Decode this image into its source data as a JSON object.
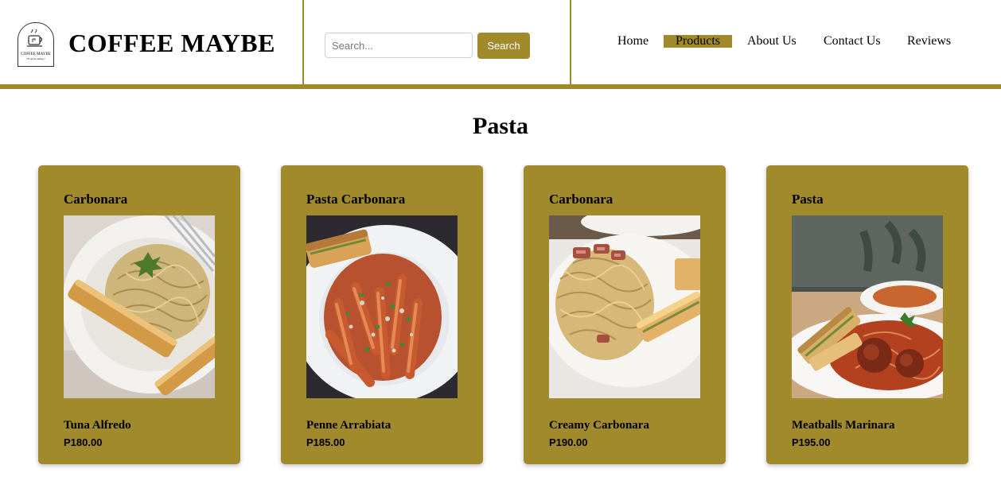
{
  "brand": {
    "name": "COFFEE MAYBE",
    "logo_text": "COFFEE MAYBE",
    "logo_tagline": "\"E sarns muitay\""
  },
  "search": {
    "placeholder": "Search...",
    "value": "",
    "button_label": "Search"
  },
  "nav": {
    "items": [
      "Home",
      "Products",
      "About Us",
      "Contact Us",
      "Reviews"
    ],
    "active": "Products"
  },
  "page": {
    "title": "Pasta"
  },
  "products": [
    {
      "category": "Carbonara",
      "name": "Tuna Alfredo",
      "price": "P180.00",
      "image": "pasta-photo"
    },
    {
      "category": "Pasta Carbonara",
      "name": "Penne Arrabiata",
      "price": "P185.00",
      "image": "pasta-photo"
    },
    {
      "category": "Carbonara",
      "name": "Creamy Carbonara",
      "price": "P190.00",
      "image": "pasta-photo"
    },
    {
      "category": "Pasta",
      "name": "Meatballs Marinara",
      "price": "P195.00",
      "image": "pasta-photo"
    }
  ],
  "colors": {
    "accent": "#a08a2c",
    "button_text": "#ffffff",
    "background": "#ffffff"
  }
}
